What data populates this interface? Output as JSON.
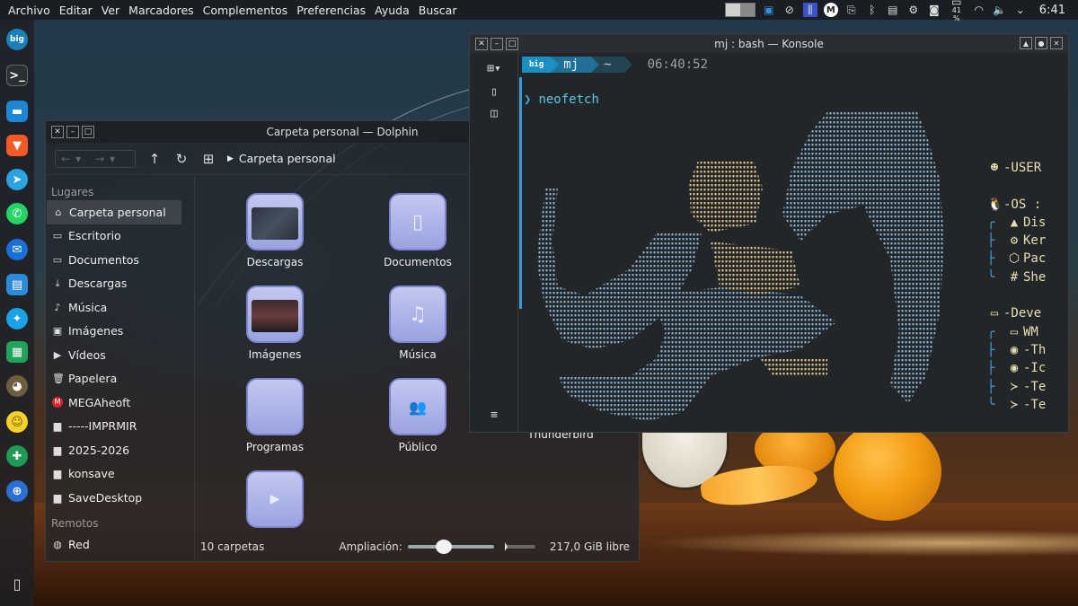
{
  "menubar": {
    "items": [
      "Archivo",
      "Editar",
      "Ver",
      "Marcadores",
      "Complementos",
      "Preferencias",
      "Ayuda",
      "Buscar"
    ]
  },
  "tray": {
    "battery_percent": "41 %",
    "clock": "6:41",
    "icons": [
      "pager-icon",
      "window-icon",
      "kdeconnect-icon",
      "equalizer-icon",
      "mega-icon",
      "clipboard-icon",
      "bluetooth-icon",
      "notes-icon",
      "settings-icon",
      "screenshot-icon",
      "battery-icon",
      "wifi-icon",
      "volume-icon",
      "chevron-down-icon"
    ]
  },
  "dock": {
    "apps": [
      "biglinux-icon",
      "terminal-icon",
      "files-icon",
      "brave-icon",
      "telegram-icon",
      "whatsapp-icon",
      "thunderbird-icon",
      "writer-icon",
      "kstars-icon",
      "calc-icon",
      "gimp-icon",
      "emoji-icon",
      "tools-icon",
      "gamepad-icon",
      "trash-icon"
    ]
  },
  "dolphin": {
    "title": "Carpeta personal — Dolphin",
    "breadcrumb": "Carpeta personal",
    "places_header": "Lugares",
    "places": [
      {
        "label": "Carpeta personal",
        "icon": "⌂",
        "active": true
      },
      {
        "label": "Escritorio",
        "icon": "▭",
        "active": false
      },
      {
        "label": "Documentos",
        "icon": "▭",
        "active": false
      },
      {
        "label": "Descargas",
        "icon": "⤓",
        "active": false
      },
      {
        "label": "Música",
        "icon": "♪",
        "active": false
      },
      {
        "label": "Imágenes",
        "icon": "▣",
        "active": false
      },
      {
        "label": "Vídeos",
        "icon": "▶",
        "active": false
      },
      {
        "label": "Papelera",
        "icon": "🗑",
        "active": false
      },
      {
        "label": "MEGAheoft",
        "icon": "M",
        "active": false
      },
      {
        "label": "-----IMPRMIR",
        "icon": "▆",
        "active": false
      },
      {
        "label": "2025-2026",
        "icon": "▆",
        "active": false
      },
      {
        "label": "konsave",
        "icon": "▆",
        "active": false
      },
      {
        "label": "SaveDesktop",
        "icon": "▆",
        "active": false
      }
    ],
    "remote_header": "Remotos",
    "remote": [
      {
        "label": "Red",
        "icon": "◍"
      }
    ],
    "folders": [
      {
        "label": "Descargas",
        "glyph": ""
      },
      {
        "label": "Documentos",
        "glyph": "▯"
      },
      {
        "label": "Imágenes",
        "glyph": ""
      },
      {
        "label": "Música",
        "glyph": "♫"
      },
      {
        "label": "Programas",
        "glyph": ""
      },
      {
        "label": "Público",
        "glyph": "👥"
      },
      {
        "label": "Thunderbird",
        "glyph": ""
      },
      {
        "label": "",
        "glyph": "▶"
      }
    ],
    "status": {
      "count": "10 carpetas",
      "zoom_label": "Ampliación:",
      "zoom_level": 0.4,
      "free_space": "217,0 GiB libre"
    }
  },
  "konsole": {
    "title": "mj : bash — Konsole",
    "prompt": {
      "logo": "big",
      "user": "mj",
      "dir": "~",
      "time": "06:40:52"
    },
    "command": "neofetch",
    "info": [
      {
        "branch": "",
        "icon": "☻",
        "text": "-USER"
      },
      {
        "branch": "",
        "icon": "",
        "text": ""
      },
      {
        "branch": "",
        "icon": "🐧",
        "text": "-OS :"
      },
      {
        "branch": "╭",
        "icon": "▲",
        "text": "Dis"
      },
      {
        "branch": "├",
        "icon": "⚙",
        "text": "Ker"
      },
      {
        "branch": "├",
        "icon": "⬡",
        "text": "Pac"
      },
      {
        "branch": "╰",
        "icon": "#",
        "text": "She"
      },
      {
        "branch": "",
        "icon": "",
        "text": ""
      },
      {
        "branch": "",
        "icon": "▭",
        "text": "-Deve"
      },
      {
        "branch": "╭",
        "icon": "▭",
        "text": "WM"
      },
      {
        "branch": "├",
        "icon": "◉",
        "text": "-Th"
      },
      {
        "branch": "├",
        "icon": "◉",
        "text": "-Ic"
      },
      {
        "branch": "├",
        "icon": "≻",
        "text": "-Te"
      },
      {
        "branch": "╰",
        "icon": "≻",
        "text": "-Te"
      }
    ]
  }
}
